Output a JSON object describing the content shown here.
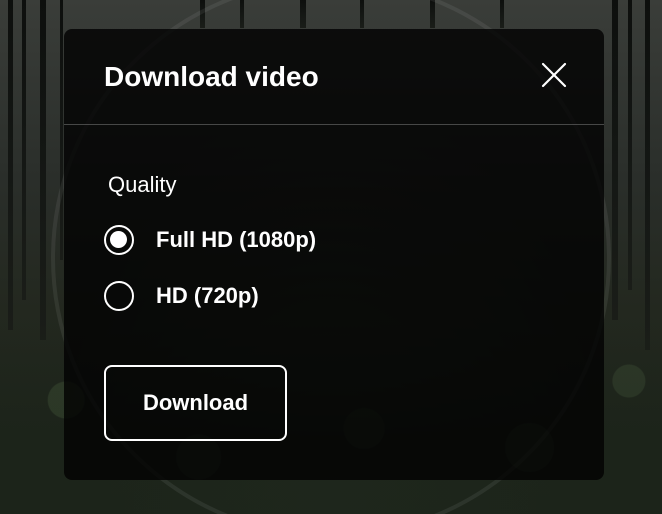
{
  "dialog": {
    "title": "Download video",
    "close_icon": "close-icon",
    "quality_label": "Quality",
    "options": [
      {
        "label": "Full HD (1080p)",
        "checked": true
      },
      {
        "label": "HD (720p)",
        "checked": false
      }
    ],
    "download_label": "Download"
  },
  "colors": {
    "dialog_background": "#050505",
    "text": "#ffffff"
  }
}
